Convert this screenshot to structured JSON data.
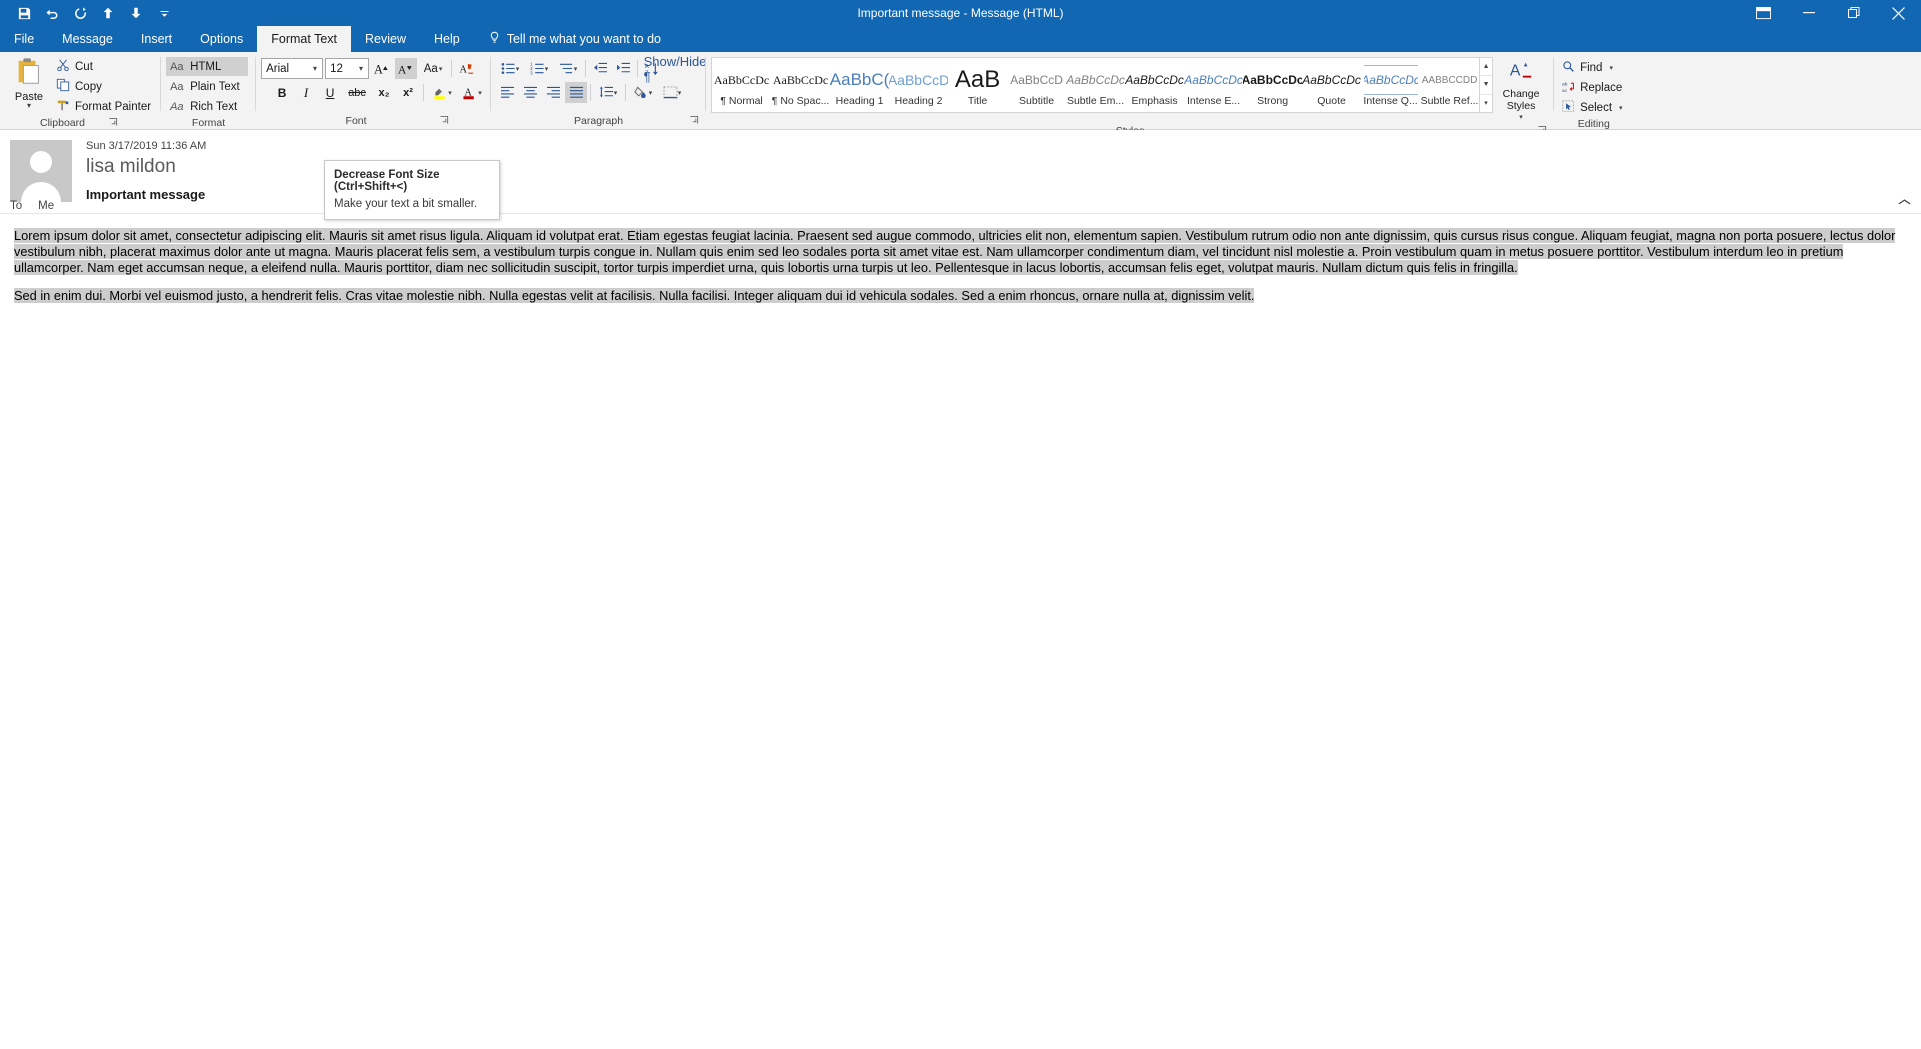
{
  "window": {
    "title": "Important message  -  Message (HTML)",
    "quick_access": [
      {
        "name": "save-icon",
        "label": "Save"
      },
      {
        "name": "undo-icon",
        "label": "Undo"
      },
      {
        "name": "redo-icon",
        "label": "Redo"
      },
      {
        "name": "previous-item-icon",
        "label": "Previous Item"
      },
      {
        "name": "next-item-icon",
        "label": "Next Item"
      },
      {
        "name": "customize-quick-access-toolbar-icon",
        "label": "Customize Quick Access Toolbar"
      }
    ],
    "controls": [
      {
        "name": "ribbon-display-options-button",
        "label": "Ribbon Display Options"
      },
      {
        "name": "minimize-button",
        "label": "Minimize"
      },
      {
        "name": "restore-button",
        "label": "Restore Down"
      },
      {
        "name": "close-button",
        "label": "Close"
      }
    ]
  },
  "tabs": [
    {
      "label": "File",
      "active": false
    },
    {
      "label": "Message",
      "active": false
    },
    {
      "label": "Insert",
      "active": false
    },
    {
      "label": "Options",
      "active": false
    },
    {
      "label": "Format Text",
      "active": true
    },
    {
      "label": "Review",
      "active": false
    },
    {
      "label": "Help",
      "active": false
    }
  ],
  "tellme": {
    "label": "Tell me what you want to do"
  },
  "ribbon": {
    "groups": {
      "clipboard": {
        "label": "Clipboard",
        "paste": "Paste",
        "items": [
          {
            "label": "Cut",
            "icon": "scissors-icon"
          },
          {
            "label": "Copy",
            "icon": "copy-icon"
          },
          {
            "label": "Format Painter",
            "icon": "format-painter-icon"
          }
        ]
      },
      "format": {
        "label": "Format",
        "items": [
          {
            "label": "HTML",
            "selected": true
          },
          {
            "label": "Plain Text",
            "selected": false
          },
          {
            "label": "Rich Text",
            "selected": false
          }
        ]
      },
      "font": {
        "label": "Font",
        "font_name": "Arial",
        "font_size": "12",
        "grow_font": "Increase Font Size",
        "shrink_font": "Decrease Font Size",
        "change_case": "Change Case",
        "clear_formatting": "Clear All Formatting",
        "bold": "B",
        "italic": "I",
        "underline": "U",
        "strikethrough": "abc",
        "subscript": "x₂",
        "superscript": "x²",
        "highlight": "Text Highlight Color",
        "fontcolor": "Font Color"
      },
      "paragraph": {
        "label": "Paragraph",
        "bullets": "Bullets",
        "numbering": "Numbering",
        "multilevel": "Multilevel List",
        "decrease_indent": "Decrease Indent",
        "increase_indent": "Increase Indent",
        "sort": "Sort",
        "show_marks": "Show/Hide ¶",
        "align_left": "Align Left",
        "center": "Center",
        "align_right": "Align Right",
        "justify": "Justify",
        "line_spacing": "Line and Paragraph Spacing",
        "shading": "Shading",
        "borders": "Borders"
      },
      "styles": {
        "label": "Styles",
        "change_styles": "Change Styles",
        "items": [
          {
            "preview": "AaBbCcDc",
            "name": "¶ Normal"
          },
          {
            "preview": "AaBbCcDc",
            "name": "¶ No Spac..."
          },
          {
            "preview": "AaBbC(",
            "name": "Heading 1"
          },
          {
            "preview": "AaBbCcD",
            "name": "Heading 2"
          },
          {
            "preview": "AaB",
            "name": "Title"
          },
          {
            "preview": "AaBbCcD",
            "name": "Subtitle"
          },
          {
            "preview": "AaBbCcDc",
            "name": "Subtle Em..."
          },
          {
            "preview": "AaBbCcDc",
            "name": "Emphasis"
          },
          {
            "preview": "AaBbCcDc",
            "name": "Intense E..."
          },
          {
            "preview": "AaBbCcDc",
            "name": "Strong"
          },
          {
            "preview": "AaBbCcDc",
            "name": "Quote"
          },
          {
            "preview": "AaBbCcDc",
            "name": "Intense Q..."
          },
          {
            "preview": "AABBCCDD",
            "name": "Subtle Ref..."
          }
        ]
      },
      "editing": {
        "label": "Editing",
        "items": [
          {
            "label": "Find",
            "icon": "search-icon",
            "caret": true
          },
          {
            "label": "Replace",
            "icon": "replace-icon",
            "caret": false
          },
          {
            "label": "Select",
            "icon": "select-icon",
            "caret": true
          }
        ]
      }
    }
  },
  "tooltip": {
    "title": "Decrease Font Size (Ctrl+Shift+<)",
    "description": "Make your text a bit smaller."
  },
  "message": {
    "date": "Sun 3/17/2019 11:36 AM",
    "from": "lisa mildon",
    "subject": "Important message",
    "to_label": "To",
    "to_value": "Me",
    "paragraphs": [
      "Lorem ipsum dolor sit amet, consectetur adipiscing elit. Mauris sit amet risus ligula. Aliquam id volutpat erat. Etiam egestas feugiat lacinia. Praesent sed augue commodo, ultricies elit non, elementum sapien. Vestibulum rutrum odio non ante dignissim, quis cursus risus congue. Aliquam feugiat, magna non porta posuere, lectus dolor vestibulum nibh, placerat maximus dolor ante ut magna. Mauris placerat felis sem, a vestibulum turpis congue in. Nullam quis enim sed leo sodales porta sit amet vitae est. Nam ullamcorper condimentum diam, vel tincidunt nisl molestie a. Proin vestibulum quam in metus posuere porttitor. Vestibulum interdum leo in pretium ullamcorper. Nam eget accumsan neque, a eleifend nulla. Mauris porttitor, diam nec sollicitudin suscipit, tortor turpis imperdiet urna, quis lobortis urna turpis ut leo. Pellentesque in lacus lobortis, accumsan felis eget, volutpat mauris. Nullam dictum quis felis in fringilla.",
      "Sed in enim dui. Morbi vel euismod justo, a hendrerit felis. Cras vitae molestie nibh. Nulla egestas velit at facilisis. Nulla facilisi. Integer aliquam dui id vehicula sodales. Sed a enim rhoncus, ornare nulla at, dignissim velit."
    ]
  },
  "colors": {
    "accent": "#1267b2",
    "selection": "#cdcdcd",
    "ribbon_bg": "#f3f3f3"
  }
}
